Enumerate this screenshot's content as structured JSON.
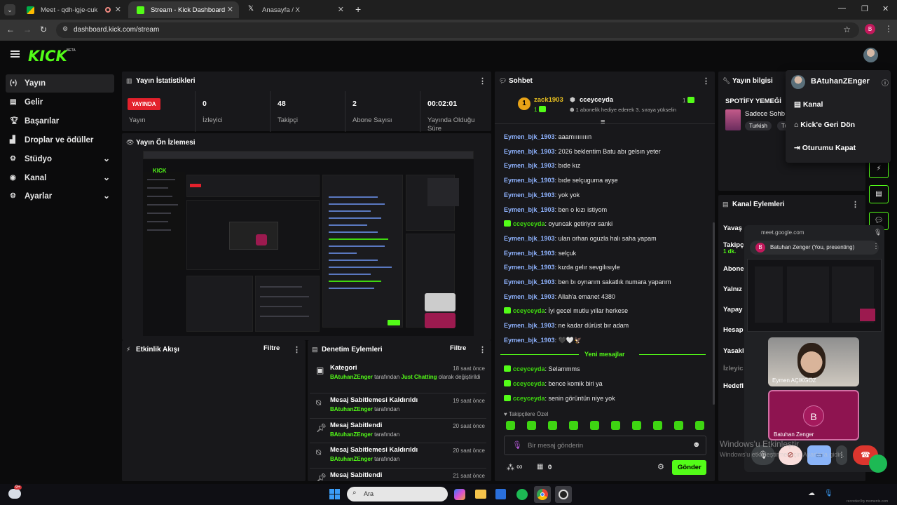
{
  "browser": {
    "tabs": [
      {
        "title": "Meet - qdh-igje-cuk",
        "active": false
      },
      {
        "title": "Stream - Kick Dashboard",
        "active": true
      },
      {
        "title": "Anasayfa / X",
        "active": false
      }
    ],
    "url": "dashboard.kick.com/stream",
    "profile_letter": "B"
  },
  "header": {
    "logo": "KICK",
    "beta": "BETA"
  },
  "sidebar": {
    "items": [
      {
        "label": "Yayın",
        "icon": "broadcast-icon",
        "active": true
      },
      {
        "label": "Gelir",
        "icon": "revenue-icon"
      },
      {
        "label": "Başarılar",
        "icon": "trophy-icon"
      },
      {
        "label": "Droplar ve ödüller",
        "icon": "drops-icon"
      },
      {
        "label": "Stüdyo",
        "icon": "studio-icon",
        "expandable": true
      },
      {
        "label": "Kanal",
        "icon": "channel-icon",
        "expandable": true
      },
      {
        "label": "Ayarlar",
        "icon": "settings-icon",
        "expandable": true
      }
    ]
  },
  "stats": {
    "title": "Yayın İstatistikleri",
    "live_badge": "YAYINDA",
    "live_label": "Yayın",
    "viewers": "0",
    "viewers_label": "İzleyici",
    "followers": "48",
    "followers_label": "Takipçi",
    "subs": "2",
    "subs_label": "Abone Sayısı",
    "uptime": "00:02:01",
    "uptime_label": "Yayında Olduğu Süre"
  },
  "preview": {
    "title": "Yayın Ön İzlemesi"
  },
  "activity": {
    "title": "Etkinlik Akışı",
    "filter": "Filtre"
  },
  "modlog": {
    "title": "Denetim Eylemleri",
    "filter": "Filtre",
    "rows": [
      {
        "title": "Kategori",
        "user": "BAtuhanZEnger",
        "mid": " tarafından ",
        "extra": "Just Chatting",
        "tail": " olarak değiştirildi",
        "time": "18 saat önce"
      },
      {
        "title": "Mesaj Sabitlemesi Kaldırıldı",
        "user": "BAtuhanZEnger",
        "tail": " tarafından",
        "time": "19 saat önce"
      },
      {
        "title": "Mesaj Sabitlendi",
        "user": "BAtuhanZEnger",
        "tail": " tarafından",
        "time": "20 saat önce"
      },
      {
        "title": "Mesaj Sabitlemesi Kaldırıldı",
        "user": "BAtuhanZEnger",
        "tail": " tarafından",
        "time": "20 saat önce"
      },
      {
        "title": "Mesaj Sabitlendi",
        "time": "21 saat önce"
      }
    ]
  },
  "chat": {
    "title": "Sohbet",
    "pinned": {
      "rank": "1",
      "user1": "zack1903",
      "count1": "1",
      "user2": "cceyceyda",
      "count2": "1",
      "note": "1 abonelik hediye ederek 3. sıraya yükselin"
    },
    "messages": [
      {
        "user": "Eymen_bjk_1903",
        "text": ": aaamıııııııın",
        "type": "u1"
      },
      {
        "user": "Eymen_bjk_1903",
        "text": ": 2026 beklentim Batu abı gelsın yeter",
        "type": "u1"
      },
      {
        "user": "Eymen_bjk_1903",
        "text": ": bıde kız",
        "type": "u1"
      },
      {
        "user": "Eymen_bjk_1903",
        "text": ": bıde selçuguma ayşe",
        "type": "u1"
      },
      {
        "user": "Eymen_bjk_1903",
        "text": ": yok yok",
        "type": "u1"
      },
      {
        "user": "Eymen_bjk_1903",
        "text": ": ben o kızı istiyom",
        "type": "u1"
      },
      {
        "user": "cceyceyda",
        "text": ": oyuncak getiriyor sanki",
        "type": "u2"
      },
      {
        "user": "Eymen_bjk_1903",
        "text": ": ulan orhan oguzla halı saha yapam",
        "type": "u1"
      },
      {
        "user": "Eymen_bjk_1903",
        "text": ": selçuk",
        "type": "u1"
      },
      {
        "user": "Eymen_bjk_1903",
        "text": ": kızda gelır sevgilısıyle",
        "type": "u1"
      },
      {
        "user": "Eymen_bjk_1903",
        "text": ": ben bı oynarım sakatlık numara yaparım",
        "type": "u1"
      },
      {
        "user": "Eymen_bjk_1903",
        "text": ": Allah'a emanet 4380",
        "type": "u1"
      },
      {
        "user": "cceyceyda",
        "text": ": İyi gecel mutlu yıllar herkese",
        "type": "u2"
      },
      {
        "user": "Eymen_bjk_1903",
        "text": ": ne kadar dürüst bır adam",
        "type": "u1"
      },
      {
        "user": "Eymen_bjk_1903",
        "text": ": 🖤🤍🦅",
        "type": "u1"
      }
    ],
    "new_messages_label": "Yeni mesajlar",
    "new_messages": [
      {
        "user": "cceyceyda",
        "text": ": Selammms"
      },
      {
        "user": "cceyceyda",
        "text": ": bence komik biri ya"
      },
      {
        "user": "cceyceyda",
        "text": ": senin görüntün niye yok"
      }
    ],
    "followers_only": "Takipçilere Özel",
    "input_placeholder": "Bir mesaj gönderin",
    "viewers_count": "∞",
    "store_count": "0",
    "send": "Gönder"
  },
  "info": {
    "title": "Yayın bilgisi",
    "stream_title": "SPOTİFY YEMEĞİ",
    "category": "Sadece Sohb",
    "tags": [
      "Turkish",
      "Tü"
    ]
  },
  "channel_actions": {
    "title": "Kanal Eylemleri",
    "items": [
      "Yavaş",
      "Takipç",
      "1 dk.",
      "Abone",
      "Yalnız",
      "Yapay",
      "Hesap",
      "Yasakl",
      "İzleyic",
      "Hedefl"
    ]
  },
  "dropdown": {
    "username": "BAtuhanZEnger",
    "items": [
      "Kanal",
      "Kick'e Geri Dön",
      "Oturumu Kapat"
    ]
  },
  "meet": {
    "url": "meet.google.com",
    "presenter": "Batuhan Zenger (You, presenting)",
    "presenter_letter": "B",
    "tile1_name": "Eymen AÇIKGÖZ",
    "tile2_name": "Batuhan Zenger",
    "tile2_letter": "B"
  },
  "windows_watermark": {
    "line1": "Windows'u Etkinleştir",
    "line2": "Windows'u etkinleştirmek için Ayarlar'a gidin."
  },
  "taskbar": {
    "search": "Ara",
    "weather_badge": "9+",
    "watermark": "recorded by moments.com"
  },
  "colors": {
    "brand": "#53fc18",
    "live": "#e3212c",
    "chat_user": "#8fb3ff",
    "panel": "#18181b"
  }
}
